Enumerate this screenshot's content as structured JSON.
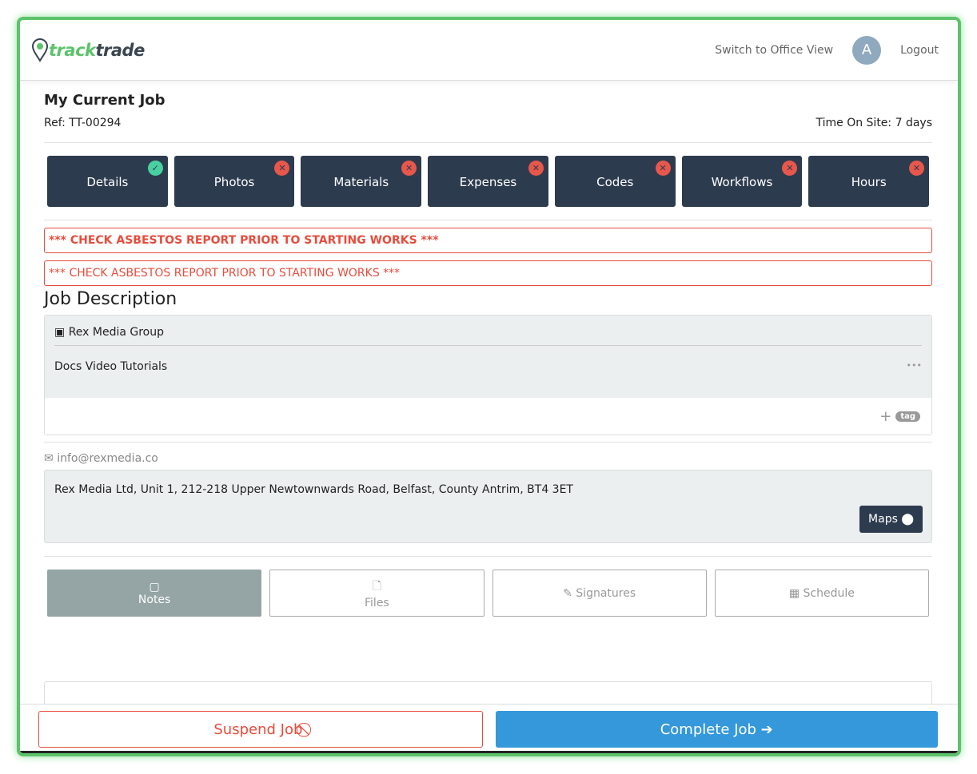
{
  "header": {
    "logo_green": "track",
    "logo_dark": "trade",
    "switch_view": "Switch to Office View",
    "avatar": "A",
    "logout": "Logout"
  },
  "job": {
    "title": "My Current Job",
    "ref": "Ref: TT-00294",
    "time_on_site": "Time On Site: 7 days"
  },
  "tabs": [
    {
      "label": "Details",
      "status": "complete"
    },
    {
      "label": "Photos",
      "status": "incomplete"
    },
    {
      "label": "Materials",
      "status": "incomplete"
    },
    {
      "label": "Expenses",
      "status": "incomplete"
    },
    {
      "label": "Codes",
      "status": "incomplete"
    },
    {
      "label": "Workflows",
      "status": "incomplete"
    },
    {
      "label": "Hours",
      "status": "incomplete"
    }
  ],
  "alerts": [
    "*** CHECK ASBESTOS REPORT PRIOR TO STARTING WORKS ***",
    "*** CHECK ASBESTOS REPORT PRIOR TO STARTING WORKS ***"
  ],
  "description": {
    "heading": "Job Description",
    "client": "Rex Media Group",
    "text": "Docs Video Tutorials",
    "more": "•••",
    "tag_add": "+",
    "tag": "tag"
  },
  "contact": {
    "email": "info@rexmedia.co",
    "address": "Rex Media Ltd, Unit 1, 212-218 Upper Newtownwards Road, Belfast, County Antrim, BT4 3ET",
    "maps": "Maps"
  },
  "bottom_tabs": [
    {
      "label": "Notes",
      "icon": "note-icon",
      "active": true
    },
    {
      "label": "Files",
      "icon": "file-icon"
    },
    {
      "label": "Signatures",
      "icon": "pencil-icon"
    },
    {
      "label": "Schedule",
      "icon": "calendar-icon"
    }
  ],
  "footer": {
    "suspend": "Suspend Job",
    "complete": "Complete Job"
  },
  "colors": {
    "accent": "#5cc36a",
    "navy": "#2d3b4f",
    "danger": "#e74c3c",
    "primary": "#3498db"
  }
}
